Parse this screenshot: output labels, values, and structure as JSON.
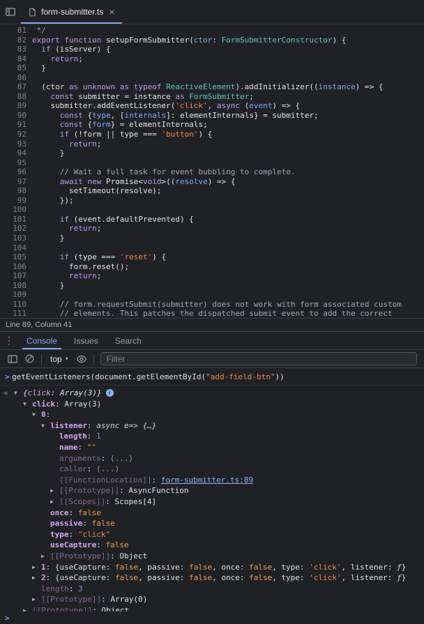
{
  "icons": {
    "menu_dots": "⋮",
    "close": "×",
    "caret": "▾",
    "prompt": ">",
    "result_marker": "«",
    "info": "i",
    "triangle_open": "▼",
    "triangle_closed": "▶"
  },
  "colors": {
    "background": "#202124",
    "accent_blue": "#7cacf8",
    "link_blue": "#8ab4f8",
    "keyword_purple": "#bd9df6",
    "string_orange": "#f28b54",
    "type_teal": "#5cc9b6",
    "key_purple": "#d6a8f5",
    "number_violet": "#9980ff"
  },
  "sources": {
    "tab": {
      "title": "form-submitter.ts"
    },
    "status": "Line 89, Column 41",
    "lines": [
      {
        "n": 81,
        "t": [
          [
            "c",
            " */"
          ]
        ]
      },
      {
        "n": 82,
        "t": [
          [
            "k",
            "export"
          ],
          [
            "pl",
            " "
          ],
          [
            "k",
            "function"
          ],
          [
            "pl",
            " setupFormSubmitter("
          ],
          [
            "d",
            "ctor"
          ],
          [
            "pl",
            ": "
          ],
          [
            "t",
            "FormSubmitterConstructor"
          ],
          [
            "pl",
            ") {"
          ]
        ]
      },
      {
        "n": 83,
        "t": [
          [
            "pl",
            "  "
          ],
          [
            "k",
            "if"
          ],
          [
            "pl",
            " (isServer) {"
          ]
        ]
      },
      {
        "n": 84,
        "t": [
          [
            "pl",
            "    "
          ],
          [
            "k",
            "return"
          ],
          [
            "pl",
            ";"
          ]
        ]
      },
      {
        "n": 85,
        "t": [
          [
            "pl",
            "  }"
          ]
        ]
      },
      {
        "n": 86,
        "t": []
      },
      {
        "n": 87,
        "t": [
          [
            "pl",
            "  (ctor "
          ],
          [
            "k",
            "as"
          ],
          [
            "pl",
            " "
          ],
          [
            "k",
            "unknown"
          ],
          [
            "pl",
            " "
          ],
          [
            "k",
            "as"
          ],
          [
            "pl",
            " "
          ],
          [
            "k",
            "typeof"
          ],
          [
            "pl",
            " "
          ],
          [
            "t",
            "ReactiveElement"
          ],
          [
            "pl",
            ").addInitializer(("
          ],
          [
            "d",
            "instance"
          ],
          [
            "pl",
            ") => {"
          ]
        ]
      },
      {
        "n": 88,
        "t": [
          [
            "pl",
            "    "
          ],
          [
            "k",
            "const"
          ],
          [
            "pl",
            " submitter = instance "
          ],
          [
            "k",
            "as"
          ],
          [
            "pl",
            " "
          ],
          [
            "t",
            "FormSubmitter"
          ],
          [
            "pl",
            ";"
          ]
        ]
      },
      {
        "n": 89,
        "t": [
          [
            "pl",
            "    submitter.addEventListener("
          ],
          [
            "s",
            "'click'"
          ],
          [
            "pl",
            ", "
          ],
          [
            "k",
            "async"
          ],
          [
            "pl",
            " ("
          ],
          [
            "d",
            "event"
          ],
          [
            "pl",
            ") => {"
          ]
        ]
      },
      {
        "n": 90,
        "t": [
          [
            "pl",
            "      "
          ],
          [
            "k",
            "const"
          ],
          [
            "pl",
            " {"
          ],
          [
            "d",
            "type"
          ],
          [
            "pl",
            ", ["
          ],
          [
            "d",
            "internals"
          ],
          [
            "pl",
            "]: elementInternals} = submitter;"
          ]
        ]
      },
      {
        "n": 91,
        "t": [
          [
            "pl",
            "      "
          ],
          [
            "k",
            "const"
          ],
          [
            "pl",
            " {"
          ],
          [
            "d",
            "form"
          ],
          [
            "pl",
            "} = elementInternals;"
          ]
        ]
      },
      {
        "n": 92,
        "t": [
          [
            "pl",
            "      "
          ],
          [
            "k",
            "if"
          ],
          [
            "pl",
            " (!form || type === "
          ],
          [
            "s",
            "'button'"
          ],
          [
            "pl",
            ") {"
          ]
        ]
      },
      {
        "n": 93,
        "t": [
          [
            "pl",
            "        "
          ],
          [
            "k",
            "return"
          ],
          [
            "pl",
            ";"
          ]
        ]
      },
      {
        "n": 94,
        "t": [
          [
            "pl",
            "      }"
          ]
        ]
      },
      {
        "n": 95,
        "t": []
      },
      {
        "n": 96,
        "t": [
          [
            "pl",
            "      "
          ],
          [
            "c",
            "// Wait a full task for event bubbling to complete."
          ]
        ]
      },
      {
        "n": 97,
        "t": [
          [
            "pl",
            "      "
          ],
          [
            "k",
            "await"
          ],
          [
            "pl",
            " "
          ],
          [
            "k",
            "new"
          ],
          [
            "pl",
            " Promise<"
          ],
          [
            "k",
            "void"
          ],
          [
            "pl",
            ">(("
          ],
          [
            "d",
            "resolve"
          ],
          [
            "pl",
            ") => {"
          ]
        ]
      },
      {
        "n": 98,
        "t": [
          [
            "pl",
            "        setTimeout(resolve);"
          ]
        ]
      },
      {
        "n": 99,
        "t": [
          [
            "pl",
            "      });"
          ]
        ]
      },
      {
        "n": 100,
        "t": []
      },
      {
        "n": 101,
        "t": [
          [
            "pl",
            "      "
          ],
          [
            "k",
            "if"
          ],
          [
            "pl",
            " (event.defaultPrevented) {"
          ]
        ]
      },
      {
        "n": 102,
        "t": [
          [
            "pl",
            "        "
          ],
          [
            "k",
            "return"
          ],
          [
            "pl",
            ";"
          ]
        ]
      },
      {
        "n": 103,
        "t": [
          [
            "pl",
            "      }"
          ]
        ]
      },
      {
        "n": 104,
        "t": []
      },
      {
        "n": 105,
        "t": [
          [
            "pl",
            "      "
          ],
          [
            "k",
            "if"
          ],
          [
            "pl",
            " (type === "
          ],
          [
            "s",
            "'reset'"
          ],
          [
            "pl",
            ") {"
          ]
        ]
      },
      {
        "n": 106,
        "t": [
          [
            "pl",
            "        form.reset();"
          ]
        ]
      },
      {
        "n": 107,
        "t": [
          [
            "pl",
            "        "
          ],
          [
            "k",
            "return"
          ],
          [
            "pl",
            ";"
          ]
        ]
      },
      {
        "n": 108,
        "t": [
          [
            "pl",
            "      }"
          ]
        ]
      },
      {
        "n": 109,
        "t": []
      },
      {
        "n": 110,
        "t": [
          [
            "pl",
            "      "
          ],
          [
            "c",
            "// form.requestSubmit(submitter) does not work with form associated custom"
          ]
        ]
      },
      {
        "n": 111,
        "t": [
          [
            "pl",
            "      "
          ],
          [
            "c",
            "// elements. This patches the dispatched submit event to add the correct"
          ]
        ]
      }
    ]
  },
  "drawer": {
    "tabs": [
      {
        "label": "Console",
        "selected": true
      },
      {
        "label": "Issues",
        "selected": false
      },
      {
        "label": "Search",
        "selected": false
      }
    ],
    "toolbar": {
      "context": "top",
      "filter_placeholder": "Filter"
    }
  },
  "console": {
    "command": [
      [
        "pl",
        "getEventListeners(document.getElementById("
      ],
      [
        "str",
        "\"add-field-btn\""
      ],
      [
        "pl",
        "))"
      ]
    ],
    "tree": [
      {
        "i": 0,
        "a": "open",
        "res": true,
        "info": true,
        "p": [
          [
            "it",
            "{"
          ],
          [
            "keyi",
            "click"
          ],
          [
            "it",
            ": Array(3)}"
          ]
        ]
      },
      {
        "i": 1,
        "a": "open",
        "p": [
          [
            "key",
            "click"
          ],
          [
            "pl",
            ": "
          ],
          [
            "pl",
            "Array(3)"
          ]
        ]
      },
      {
        "i": 2,
        "a": "open",
        "p": [
          [
            "key",
            "0"
          ],
          [
            "pl",
            ": "
          ]
        ]
      },
      {
        "i": 3,
        "a": "open",
        "p": [
          [
            "key",
            "listener"
          ],
          [
            "pl",
            ": "
          ],
          [
            "fn",
            "async e=> {…}"
          ]
        ]
      },
      {
        "i": 4,
        "a": "none",
        "p": [
          [
            "key",
            "length"
          ],
          [
            "pl",
            ": "
          ],
          [
            "num",
            "1"
          ]
        ]
      },
      {
        "i": 4,
        "a": "none",
        "p": [
          [
            "key",
            "name"
          ],
          [
            "pl",
            ": "
          ],
          [
            "str",
            "\"\""
          ]
        ]
      },
      {
        "i": 4,
        "a": "none",
        "p": [
          [
            "dkey",
            "arguments"
          ],
          [
            "pl",
            ": "
          ],
          [
            "dots",
            "(...)"
          ]
        ]
      },
      {
        "i": 4,
        "a": "none",
        "p": [
          [
            "dkey",
            "caller"
          ],
          [
            "pl",
            ": "
          ],
          [
            "dots",
            "(...)"
          ]
        ]
      },
      {
        "i": 4,
        "a": "none",
        "p": [
          [
            "dkey",
            "[[FunctionLocation]]"
          ],
          [
            "pl",
            ": "
          ],
          [
            "lnk",
            "form-submitter.ts:89"
          ]
        ]
      },
      {
        "i": 4,
        "a": "closed",
        "p": [
          [
            "dkey",
            "[[Prototype]]"
          ],
          [
            "pl",
            ": "
          ],
          [
            "pl",
            "AsyncFunction"
          ]
        ]
      },
      {
        "i": 4,
        "a": "closed",
        "p": [
          [
            "dkey",
            "[[Scopes]]"
          ],
          [
            "pl",
            ": "
          ],
          [
            "pl",
            "Scopes[4]"
          ]
        ]
      },
      {
        "i": 3,
        "a": "none",
        "p": [
          [
            "key",
            "once"
          ],
          [
            "pl",
            ": "
          ],
          [
            "bool",
            "false"
          ]
        ]
      },
      {
        "i": 3,
        "a": "none",
        "p": [
          [
            "key",
            "passive"
          ],
          [
            "pl",
            ": "
          ],
          [
            "bool",
            "false"
          ]
        ]
      },
      {
        "i": 3,
        "a": "none",
        "p": [
          [
            "key",
            "type"
          ],
          [
            "pl",
            ": "
          ],
          [
            "str",
            "\"click\""
          ]
        ]
      },
      {
        "i": 3,
        "a": "none",
        "p": [
          [
            "key",
            "useCapture"
          ],
          [
            "pl",
            ": "
          ],
          [
            "bool",
            "false"
          ]
        ]
      },
      {
        "i": 3,
        "a": "closed",
        "p": [
          [
            "dkey",
            "[[Prototype]]"
          ],
          [
            "pl",
            ": "
          ],
          [
            "pl",
            "Object"
          ]
        ]
      },
      {
        "i": 2,
        "a": "closed",
        "p": [
          [
            "key",
            "1"
          ],
          [
            "pl",
            ": {useCapture: "
          ],
          [
            "bool",
            "false"
          ],
          [
            "pl",
            ", passive: "
          ],
          [
            "bool",
            "false"
          ],
          [
            "pl",
            ", once: "
          ],
          [
            "bool",
            "false"
          ],
          [
            "pl",
            ", type: "
          ],
          [
            "str",
            "'click'"
          ],
          [
            "pl",
            ", listener: "
          ],
          [
            "fn",
            "ƒ"
          ],
          [
            "pl",
            "}"
          ]
        ]
      },
      {
        "i": 2,
        "a": "closed",
        "p": [
          [
            "key",
            "2"
          ],
          [
            "pl",
            ": {useCapture: "
          ],
          [
            "bool",
            "false"
          ],
          [
            "pl",
            ", passive: "
          ],
          [
            "bool",
            "false"
          ],
          [
            "pl",
            ", once: "
          ],
          [
            "bool",
            "false"
          ],
          [
            "pl",
            ", type: "
          ],
          [
            "str",
            "'click'"
          ],
          [
            "pl",
            ", listener: "
          ],
          [
            "fn",
            "ƒ"
          ],
          [
            "pl",
            "}"
          ]
        ]
      },
      {
        "i": 2,
        "a": "none",
        "p": [
          [
            "dkey",
            "length"
          ],
          [
            "pl",
            ": "
          ],
          [
            "num",
            "3"
          ]
        ]
      },
      {
        "i": 2,
        "a": "closed",
        "p": [
          [
            "dkey",
            "[[Prototype]]"
          ],
          [
            "pl",
            ": "
          ],
          [
            "pl",
            "Array(0)"
          ]
        ]
      },
      {
        "i": 1,
        "a": "closed",
        "p": [
          [
            "dkey",
            "[[Prototype]]"
          ],
          [
            "pl",
            ": "
          ],
          [
            "pl",
            "Object"
          ]
        ]
      }
    ]
  }
}
